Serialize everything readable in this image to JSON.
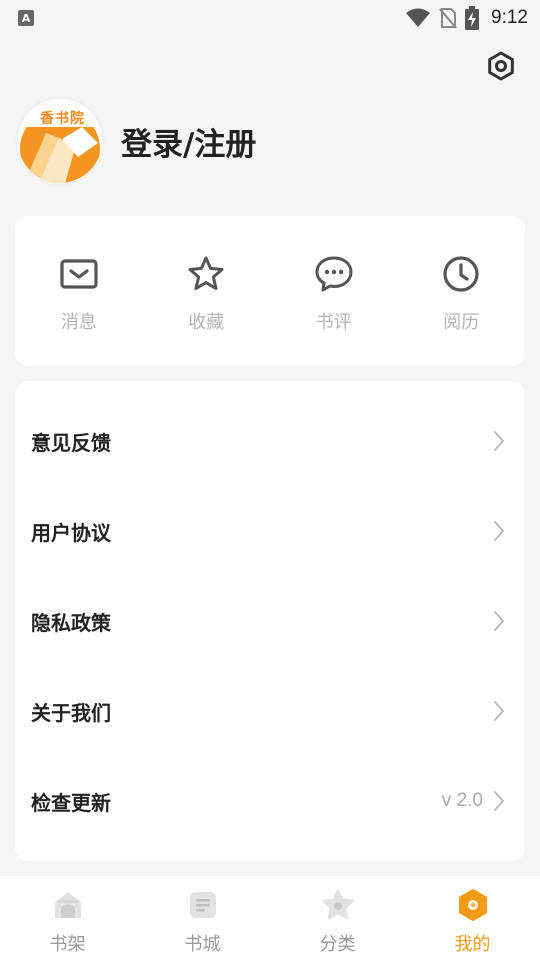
{
  "status_bar": {
    "time": "9:12",
    "left_icon_letter": "A",
    "icons": [
      "text-icon",
      "wifi-icon",
      "no-sim-icon",
      "battery-charging-icon"
    ]
  },
  "header": {
    "settings_icon": "settings-hexagon-icon",
    "login_label": "登录/注册",
    "avatar_text": "香书院"
  },
  "quick_actions": [
    {
      "label": "消息",
      "icon": "message-envelope-icon"
    },
    {
      "label": "收藏",
      "icon": "star-icon"
    },
    {
      "label": "书评",
      "icon": "comment-bubble-icon"
    },
    {
      "label": "阅历",
      "icon": "clock-icon"
    }
  ],
  "menu": [
    {
      "label": "意见反馈",
      "extra": ""
    },
    {
      "label": "用户协议",
      "extra": ""
    },
    {
      "label": "隐私政策",
      "extra": ""
    },
    {
      "label": "关于我们",
      "extra": ""
    },
    {
      "label": "检查更新",
      "extra": "v 2.0"
    }
  ],
  "bottom_nav": [
    {
      "label": "书架",
      "icon": "bookshelf-icon",
      "active": false
    },
    {
      "label": "书城",
      "icon": "bookstore-icon",
      "active": false
    },
    {
      "label": "分类",
      "icon": "category-icon",
      "active": false
    },
    {
      "label": "我的",
      "icon": "profile-hexagon-icon",
      "active": true
    }
  ],
  "colors": {
    "accent": "#f39b17",
    "background": "#f5f5f5",
    "icon_gray": "#555555",
    "label_gray": "#b5b5b5"
  }
}
